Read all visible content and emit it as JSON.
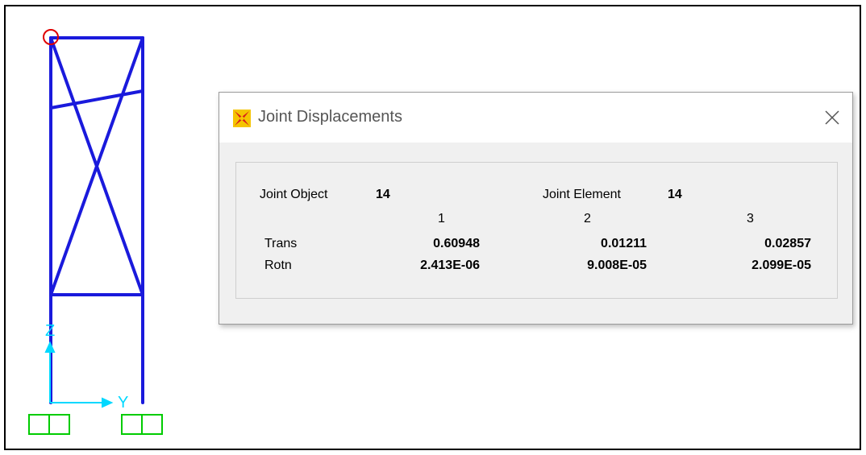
{
  "dialog": {
    "title": "Joint Displacements",
    "close_icon": "close-icon",
    "app_icon": "sap-app-icon",
    "joint_object_label": "Joint  Object",
    "joint_object_value": "14",
    "joint_element_label": "Joint Element",
    "joint_element_value": "14",
    "columns": [
      "1",
      "2",
      "3"
    ],
    "rows": [
      {
        "label": "Trans",
        "values": [
          "0.60948",
          "0.01211",
          "0.02857"
        ]
      },
      {
        "label": "Rotn",
        "values": [
          "2.413E-06",
          "9.008E-05",
          "2.099E-05"
        ]
      }
    ]
  },
  "viewport": {
    "axis_labels": {
      "z": "Z",
      "y": "Y"
    },
    "colors": {
      "frame": "#1a1adc",
      "axis": "#00d8ff",
      "support": "#00cc00",
      "selected_joint": "#e00000"
    }
  }
}
